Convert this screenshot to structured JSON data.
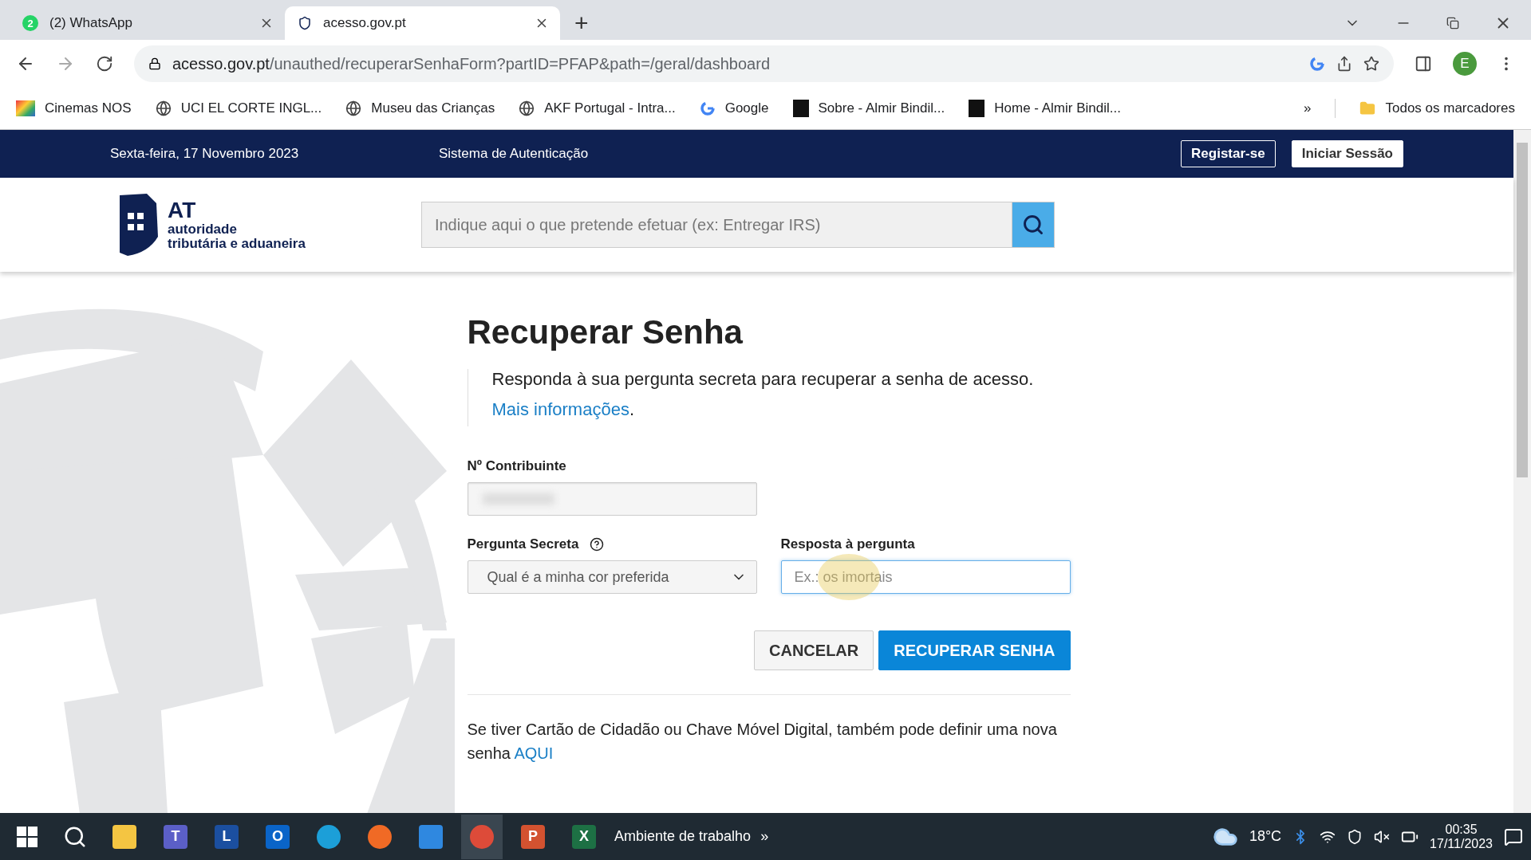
{
  "browser": {
    "tabs": [
      {
        "title": "(2) WhatsApp",
        "badge": "2",
        "kind": "chat",
        "selected": false
      },
      {
        "title": "acesso.gov.pt",
        "kind": "site",
        "selected": true
      }
    ],
    "new_tab": "+",
    "url": {
      "host": "acesso.gov.pt",
      "path": "/unauthed/recuperarSenhaForm?partID=PFAP&path=/geral/dashboard"
    },
    "profile": "E",
    "bookmarks": [
      {
        "label": "Cinemas NOS",
        "kind": "stripes"
      },
      {
        "label": "UCI EL CORTE INGL...",
        "kind": "globe"
      },
      {
        "label": "Museu das Crianças",
        "kind": "globe"
      },
      {
        "label": "AKF Portugal - Intra...",
        "kind": "globe"
      },
      {
        "label": "Google",
        "kind": "google"
      },
      {
        "label": "Sobre - Almir Bindil...",
        "kind": "dark"
      },
      {
        "label": "Home - Almir Bindil...",
        "kind": "dark"
      }
    ],
    "more_bookmarks": "»",
    "all_bookmarks": "Todos os marcadores"
  },
  "topbar": {
    "date": "Sexta-feira, 17 Novembro 2023",
    "system": "Sistema de Autenticação",
    "register": "Registar-se",
    "login": "Iniciar Sessão"
  },
  "header": {
    "logo_title": "AT",
    "logo_line1": "autoridade",
    "logo_line2": "tributária e aduaneira",
    "search": {
      "placeholder": "Indique aqui o que pretende efetuar (ex: Entregar IRS)"
    }
  },
  "form": {
    "title": "Recuperar Senha",
    "intro": "Responda à sua pergunta secreta para recuperar a senha de acesso.",
    "more_link": "Mais informações",
    "more_suffix": ".",
    "nif": {
      "label": "Nº Contribuinte",
      "blurred": true
    },
    "question": {
      "label": "Pergunta Secreta",
      "value": "Qual é a minha cor preferida"
    },
    "answer": {
      "label": "Resposta à pergunta",
      "placeholder": "Ex.: os imortais",
      "focused": true
    },
    "cancel": "CANCELAR",
    "submit": "RECUPERAR SENHA",
    "footer_text": "Se tiver Cartão de Cidadão ou Chave Móvel Digital, também pode definir uma nova senha",
    "footer_link": "AQUI"
  },
  "taskbar": {
    "apps": [
      {
        "kind": "explorer"
      },
      {
        "kind": "teams",
        "label": "T"
      },
      {
        "kind": "tile",
        "label": "L"
      },
      {
        "kind": "outlook",
        "label": "O"
      },
      {
        "kind": "edge"
      },
      {
        "kind": "firefox"
      },
      {
        "kind": "mail"
      },
      {
        "kind": "chrome",
        "selected": true
      },
      {
        "kind": "powerpoint",
        "label": "P"
      },
      {
        "kind": "excel",
        "label": "X"
      }
    ],
    "desktop": "Ambiente de trabalho",
    "chevron": "»",
    "temperature": "18°C",
    "time": "00:35",
    "date": "17/11/2023"
  }
}
